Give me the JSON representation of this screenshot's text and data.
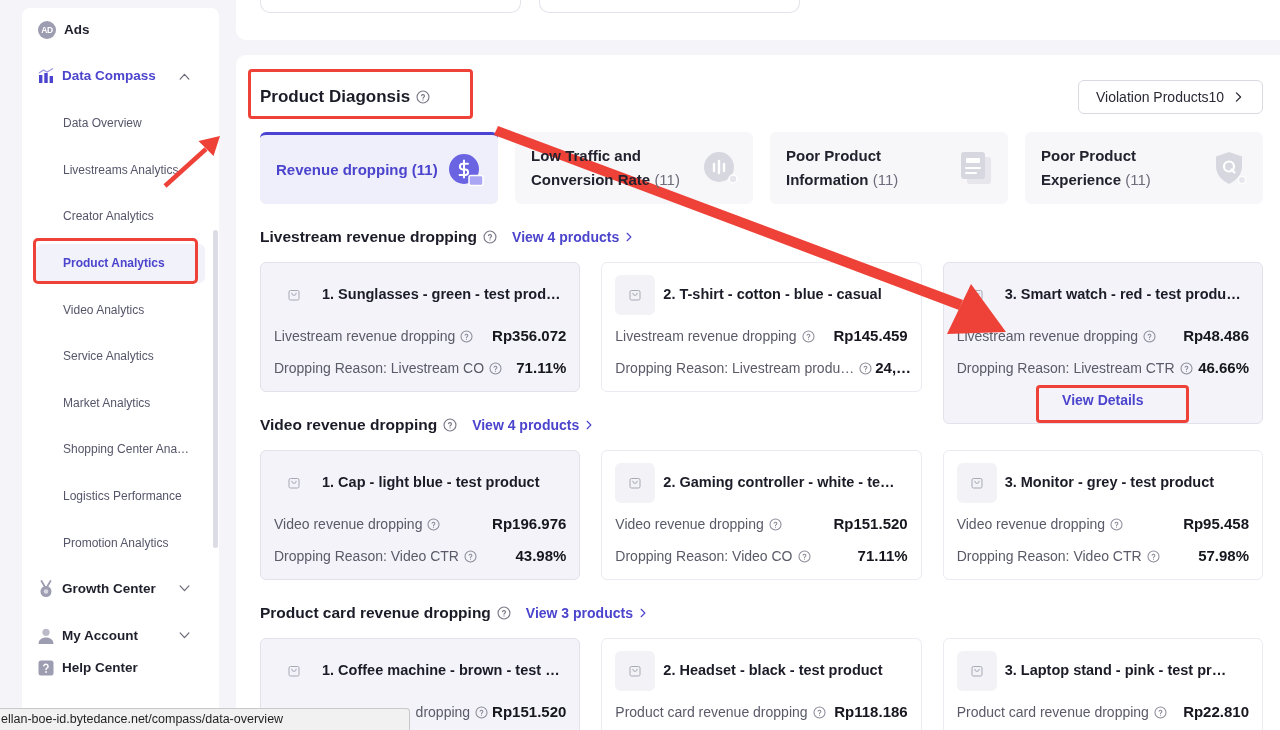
{
  "sidebar": {
    "items": [
      {
        "kind": "ad",
        "icon_text": "AD",
        "label": "Ads",
        "active": false
      },
      {
        "kind": "chart",
        "label": "Data Compass",
        "active": true,
        "expanded": true,
        "children": [
          {
            "label": "Data Overview",
            "selected": false
          },
          {
            "label": "Livestreams Analytics",
            "selected": false
          },
          {
            "label": "Creator Analytics",
            "selected": false
          },
          {
            "label": "Product Analytics",
            "selected": true
          },
          {
            "label": "Video Analytics",
            "selected": false
          },
          {
            "label": "Service Analytics",
            "selected": false
          },
          {
            "label": "Market Analytics",
            "selected": false
          },
          {
            "label": "Shopping Center Ana…",
            "selected": false
          },
          {
            "label": "Logistics Performance",
            "selected": false
          },
          {
            "label": "Promotion Analytics",
            "selected": false
          }
        ]
      },
      {
        "kind": "medal",
        "label": "Growth Center",
        "active": false,
        "expanded": false
      },
      {
        "kind": "person",
        "label": "My Account",
        "active": false,
        "expanded": false
      },
      {
        "kind": "help",
        "label": "Help Center",
        "active": false
      }
    ]
  },
  "diagnosis": {
    "title": "Product Diagonsis",
    "violation_button": "Violation Products10",
    "tabs": [
      {
        "kind": "revenue",
        "label": "Revenue dropping",
        "count": "(11)",
        "selected": true
      },
      {
        "kind": "traffic",
        "label": "Low Traffic and Conversion Rate",
        "count": "(11)",
        "selected": false
      },
      {
        "kind": "information",
        "label": "Poor Product Information",
        "count": "(11)",
        "selected": false
      },
      {
        "kind": "experience",
        "label": "Poor Product Experience",
        "count": "(11)",
        "selected": false
      }
    ]
  },
  "sections": [
    {
      "title": "Livestream revenue dropping",
      "link": "View 4 products",
      "cards": [
        {
          "title": "1. Sunglasses - green - test prod…",
          "highlighted": true,
          "metrics": [
            {
              "label": "Livestream revenue dropping",
              "value": "Rp356.072"
            },
            {
              "label": "Dropping Reason: Livestream CO",
              "value": "71.11%"
            }
          ]
        },
        {
          "title": "2. T-shirt - cotton - blue - casual",
          "highlighted": false,
          "metrics": [
            {
              "label": "Livestream revenue dropping",
              "value": "Rp145.459"
            },
            {
              "label": "Dropping Reason: Livestream produ…",
              "value": "24,…"
            }
          ]
        },
        {
          "title": "3. Smart watch - red - test produ…",
          "highlighted": true,
          "metrics": [
            {
              "label": "Livestream revenue dropping",
              "value": "Rp48.486"
            },
            {
              "label": "Dropping Reason: Livestream CTR",
              "value": "46.66%"
            }
          ],
          "action": "View Details"
        }
      ]
    },
    {
      "title": "Video revenue dropping",
      "link": "View 4 products",
      "cards": [
        {
          "title": "1. Cap - light blue - test product",
          "highlighted": true,
          "metrics": [
            {
              "label": "Video revenue dropping",
              "value": "Rp196.976"
            },
            {
              "label": "Dropping Reason: Video CTR",
              "value": "43.98%"
            }
          ]
        },
        {
          "title": "2. Gaming controller - white - te…",
          "highlighted": false,
          "metrics": [
            {
              "label": "Video revenue dropping",
              "value": "Rp151.520"
            },
            {
              "label": "Dropping Reason: Video CO",
              "value": "71.11%"
            }
          ]
        },
        {
          "title": "3. Monitor - grey - test product",
          "highlighted": false,
          "metrics": [
            {
              "label": "Video revenue dropping",
              "value": "Rp95.458"
            },
            {
              "label": "Dropping Reason: Video CTR",
              "value": "57.98%"
            }
          ]
        }
      ]
    },
    {
      "title": "Product card revenue dropping",
      "link": "View 3 products",
      "cards": [
        {
          "title": "1. Coffee machine - brown - test …",
          "highlighted": true,
          "metrics": [
            {
              "kind": "clipped",
              "label": "dropping",
              "value": "Rp151.520"
            }
          ]
        },
        {
          "title": "2. Headset - black - test product",
          "highlighted": false,
          "metrics": [
            {
              "label": "Product card revenue dropping",
              "value": "Rp118.186"
            }
          ]
        },
        {
          "title": "3. Laptop stand - pink - test pr…",
          "highlighted": false,
          "metrics": [
            {
              "label": "Product card revenue dropping",
              "value": "Rp22.810"
            }
          ]
        }
      ]
    }
  ],
  "status_bar": {
    "url": "ellan-boe-id.bytedance.net/compass/data-overview"
  }
}
